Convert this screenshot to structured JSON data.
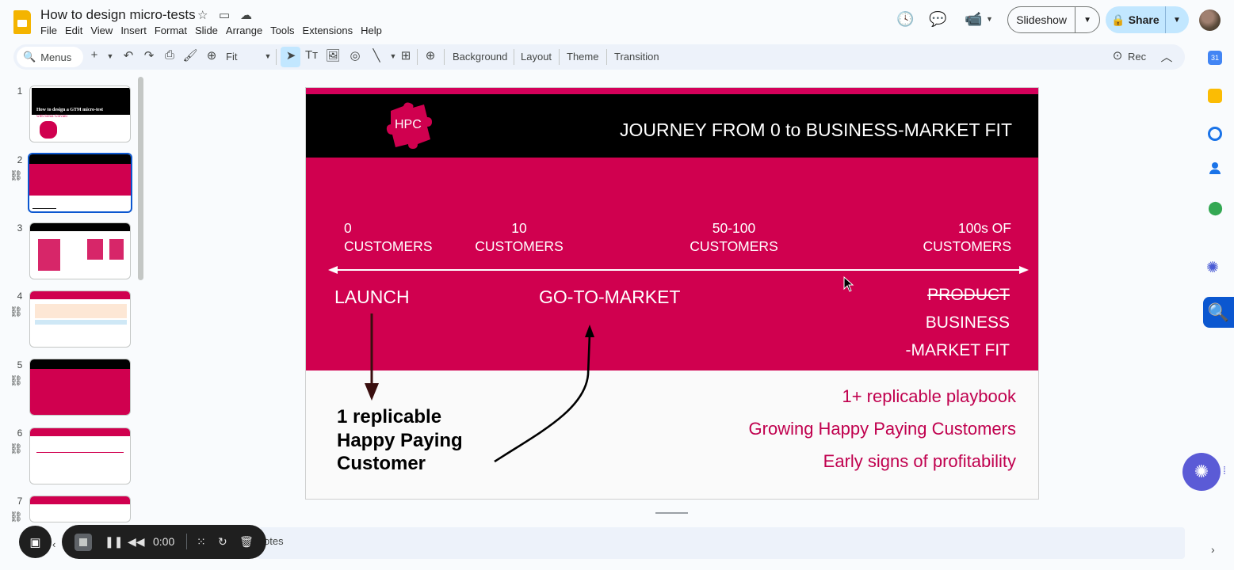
{
  "document": {
    "title": "How to design micro-tests"
  },
  "menu": [
    "File",
    "Edit",
    "View",
    "Insert",
    "Format",
    "Slide",
    "Arrange",
    "Tools",
    "Extensions",
    "Help"
  ],
  "header": {
    "slideshow_label": "Slideshow",
    "share_label": "Share"
  },
  "toolbar": {
    "search_placeholder": "Menus",
    "zoom": "Fit",
    "background": "Background",
    "layout": "Layout",
    "theme": "Theme",
    "transition": "Transition",
    "rec": "Rec"
  },
  "filmstrip": {
    "numbers": [
      "1",
      "2",
      "3",
      "4",
      "5",
      "6",
      "7"
    ],
    "slide1_title": "How to design a GTM micro-test",
    "slide1_sub": "with Sonia Giovani"
  },
  "slide": {
    "logo_text": "HPC",
    "title": "JOURNEY FROM 0 to BUSINESS-MARKET FIT",
    "customers": [
      {
        "count": "0",
        "label": "CUSTOMERS"
      },
      {
        "count": "10",
        "label": "CUSTOMERS"
      },
      {
        "count": "50-100",
        "label": "CUSTOMERS"
      },
      {
        "count": "100s OF",
        "label": "CUSTOMERS"
      }
    ],
    "stage_launch": "LAUNCH",
    "stage_gtm": "GO-TO-MARKET",
    "stage_product": "PRODUCT",
    "stage_business": "BUSINESS",
    "stage_fit": "-MARKET FIT",
    "bold_line1": "1 replicable",
    "bold_line2": "Happy Paying",
    "bold_line3": "Customer",
    "right_lines": [
      "1+ replicable playbook",
      "Growing Happy Paying Customers",
      "Early signs of profitability"
    ]
  },
  "notes": {
    "label": "otes"
  },
  "recorder": {
    "time": "0:00"
  },
  "colors": {
    "brand_pink": "#d0004f",
    "accent_blue": "#0b57d0",
    "share_bg": "#c2e7ff"
  }
}
